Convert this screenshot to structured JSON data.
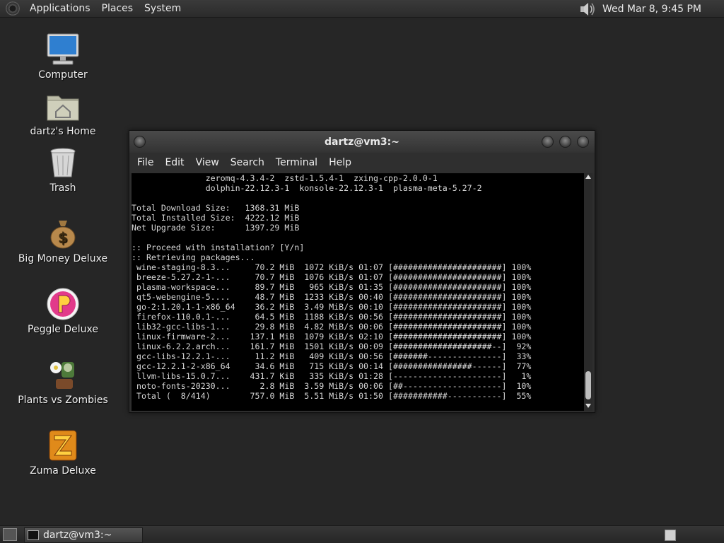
{
  "top_panel": {
    "menus": [
      "Applications",
      "Places",
      "System"
    ],
    "clock": "Wed Mar  8,  9:45 PM"
  },
  "desktop_icons": [
    {
      "label": "Computer",
      "icon": "computer-icon"
    },
    {
      "label": "dartz's Home",
      "icon": "home-folder-icon"
    },
    {
      "label": "Trash",
      "icon": "trash-icon"
    },
    {
      "label": "Big Money Deluxe",
      "icon": "money-bag-icon"
    },
    {
      "label": "Peggle Deluxe",
      "icon": "peggle-icon"
    },
    {
      "label": "Plants vs Zombies",
      "icon": "plants-vs-zombies-icon"
    },
    {
      "label": "Zuma Deluxe",
      "icon": "zuma-icon"
    }
  ],
  "window": {
    "title": "dartz@vm3:~",
    "menus": [
      "File",
      "Edit",
      "View",
      "Search",
      "Terminal",
      "Help"
    ],
    "terminal_lines": [
      "               zeromq-4.3.4-2  zstd-1.5.4-1  zxing-cpp-2.0.0-1",
      "               dolphin-22.12.3-1  konsole-22.12.3-1  plasma-meta-5.27-2",
      "",
      "Total Download Size:   1368.31 MiB",
      "Total Installed Size:  4222.12 MiB",
      "Net Upgrade Size:      1397.29 MiB",
      "",
      ":: Proceed with installation? [Y/n]",
      ":: Retrieving packages...",
      " wine-staging-8.3...     70.2 MiB  1072 KiB/s 01:07 [######################] 100%",
      " breeze-5.27.2-1-...     70.7 MiB  1076 KiB/s 01:07 [######################] 100%",
      " plasma-workspace...     89.7 MiB   965 KiB/s 01:35 [######################] 100%",
      " qt5-webengine-5....     48.7 MiB  1233 KiB/s 00:40 [######################] 100%",
      " go-2:1.20.1-1-x86_64    36.2 MiB  3.49 MiB/s 00:10 [######################] 100%",
      " firefox-110.0.1-...     64.5 MiB  1188 KiB/s 00:56 [######################] 100%",
      " lib32-gcc-libs-1...     29.8 MiB  4.82 MiB/s 00:06 [######################] 100%",
      " linux-firmware-2...    137.1 MiB  1079 KiB/s 02:10 [######################] 100%",
      " linux-6.2.2.arch...    161.7 MiB  1501 KiB/s 00:09 [####################--]  92%",
      " gcc-libs-12.2.1-...     11.2 MiB   409 KiB/s 00:56 [#######---------------]  33%",
      " gcc-12.2.1-2-x86_64     34.6 MiB   715 KiB/s 00:14 [################------]  77%",
      " llvm-libs-15.0.7...    431.7 KiB   335 KiB/s 01:28 [----------------------]   1%",
      " noto-fonts-20230...      2.8 MiB  3.59 MiB/s 00:06 [##--------------------]  10%",
      " Total (  8/414)        757.0 MiB  5.51 MiB/s 01:50 [###########-----------]  55%"
    ]
  },
  "taskbar": {
    "task_label": "dartz@vm3:~"
  }
}
